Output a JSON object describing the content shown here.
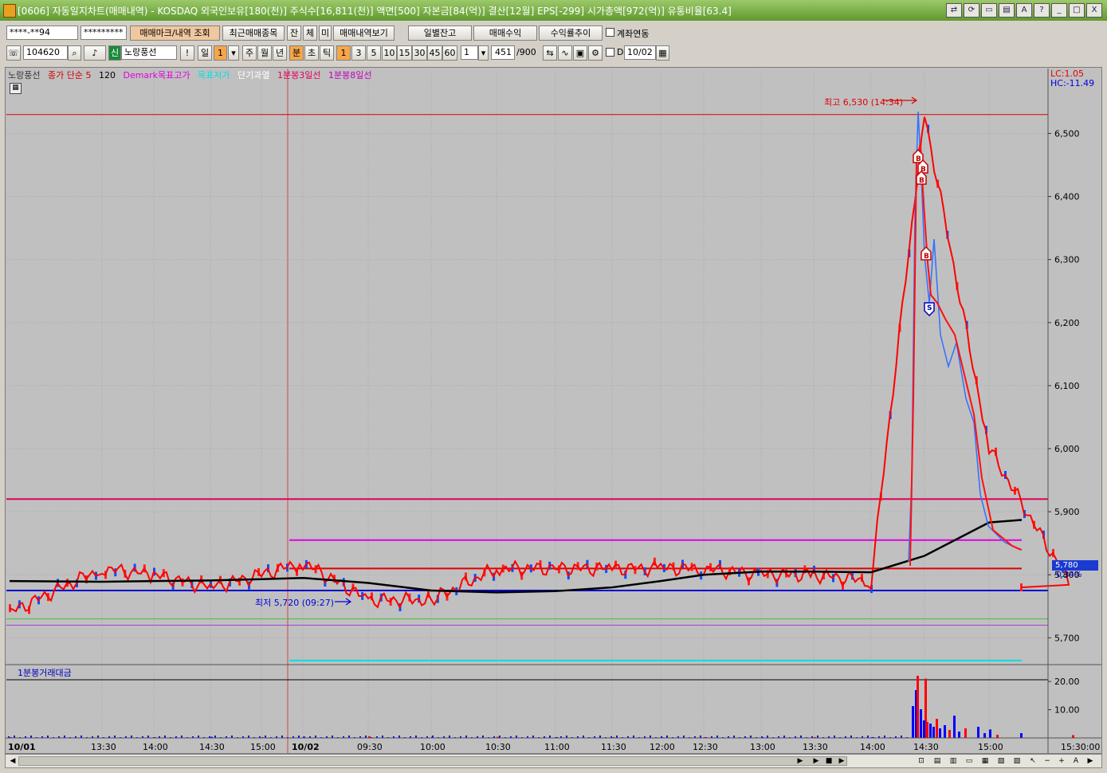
{
  "window": {
    "title": "[0606] 자동일지차트(매매내역) - KOSDAQ 외국인보유[180(천)] 주식수[16,811(천)] 액면[500] 자본금[84(억)] 결산[12월] EPS[-299] 시가총액[972(억)] 유통비율[63.4]",
    "buttons": [
      "⇄",
      "⟳",
      "▭",
      "▤",
      "A",
      "?",
      "_",
      "□",
      "X"
    ]
  },
  "toolbar1": {
    "account": "****-**94",
    "password": "*********",
    "btn_mark": "매매마크/내역 조회",
    "btn_recent": "최근매매종목",
    "btn_jan": "잔",
    "btn_che": "체",
    "btn_mi": "미",
    "btn_history": "매매내역보기",
    "btn_daily": "일별잔고",
    "btn_profit": "매매수익",
    "btn_trend": "수익률추이",
    "chk_link_label": "계좌연동"
  },
  "toolbar2": {
    "code": "104620",
    "new_badge": "신",
    "name": "노랑풍선",
    "excl": "!",
    "period_day": "일",
    "period_num": "1",
    "p_week": "주",
    "p_month": "월",
    "p_year": "년",
    "p_min": "분",
    "p_sec": "초",
    "p_tick": "틱",
    "intervals": [
      "1",
      "3",
      "5",
      "10",
      "15",
      "30",
      "45",
      "60"
    ],
    "spin_value": "1",
    "count": "451",
    "count_total": "/900",
    "chk_d_label": "D",
    "date": "10/02"
  },
  "legend": {
    "stock": "노랑풍선",
    "ma": "종가 단순 5",
    "ma2": "120",
    "demark_high": "Demark목표고가",
    "demark_low": "목표저가",
    "short_over": "단기과열",
    "line3": "1분봉3일선",
    "line8": "1분봉8일선"
  },
  "axis_info": {
    "lc": "LC:1.05",
    "hc": "HC:-11.49"
  },
  "annotations": {
    "high": "최고 6,530 (14:34)",
    "low": "최저 5,720 (09:27)",
    "current_price": "5,780",
    "current_change": "-0.34%",
    "buy_mark": "B",
    "sell_mark": "S"
  },
  "volume": {
    "title": "1분봉거래대금"
  },
  "colors": {
    "chart_bg": "#c0c0c0",
    "up": "#ff0000",
    "down": "#0000ff",
    "ma120": "#000000",
    "demark_high": "#ff00ff",
    "demark_low": "#00d8d8",
    "line3": "#e00060",
    "line8": "#a000e0"
  },
  "chart_data": {
    "type": "line",
    "title": "",
    "x": [
      "10/01",
      "13:30",
      "14:00",
      "14:30",
      "15:00",
      "10/02",
      "09:30",
      "10:00",
      "10:30",
      "11:00",
      "11:30",
      "12:00",
      "12:30",
      "13:00",
      "13:30",
      "14:00",
      "14:30",
      "15:00",
      "15:30:00"
    ],
    "y_ticks": [
      "6,500",
      "6,400",
      "6,300",
      "6,200",
      "6,100",
      "6,000",
      "5,900",
      "5,800",
      "5,700"
    ],
    "ylim": [
      5660,
      6560
    ],
    "volume_ticks": [
      "20.00",
      "10.00"
    ],
    "volume_ylim": [
      0,
      22
    ],
    "series": [
      {
        "name": "노랑풍선",
        "x": [
          "10/01",
          "13:30",
          "14:00",
          "14:30",
          "15:00",
          "10/02",
          "09:30",
          "10:00",
          "10:30",
          "11:00",
          "11:30",
          "12:00",
          "12:30",
          "13:00",
          "13:30",
          "14:00",
          "14:30",
          "15:00",
          "15:30:00"
        ],
        "values": [
          5740,
          5810,
          5800,
          5780,
          5800,
          5820,
          5760,
          5760,
          5810,
          5810,
          5810,
          5810,
          5810,
          5800,
          5800,
          5790,
          6530,
          6000,
          5780
        ]
      },
      {
        "name": "120",
        "x": [
          "10/01",
          "13:30",
          "14:00",
          "14:30",
          "15:00",
          "10/02",
          "09:30",
          "10:00",
          "10:30",
          "11:00",
          "11:30",
          "12:00",
          "12:30",
          "13:00",
          "13:30",
          "14:00",
          "14:30",
          "15:00",
          "15:30:00"
        ],
        "values": [
          5790,
          5789,
          5790,
          5791,
          5793,
          5795,
          5787,
          5775,
          5772,
          5774,
          5780,
          5790,
          5800,
          5805,
          5805,
          5804,
          5830,
          5883,
          5887
        ]
      },
      {
        "name": "1분봉거래대금",
        "x": [
          "10/01",
          "13:30",
          "14:00",
          "14:30",
          "15:00",
          "10/02",
          "09:30",
          "10:00",
          "10:30",
          "11:00",
          "11:30",
          "12:00",
          "12:30",
          "13:00",
          "13:30",
          "14:00",
          "14:30",
          "15:00",
          "15:30:00"
        ],
        "values": [
          0.3,
          0.2,
          0.3,
          0.4,
          0.3,
          0.5,
          0.6,
          0.4,
          0.4,
          0.3,
          0.3,
          0.3,
          0.3,
          0.3,
          0.3,
          0.3,
          21,
          3,
          1
        ]
      }
    ],
    "hlines": [
      {
        "name": "최고",
        "value": 6530
      },
      {
        "name": "1분봉3일선",
        "value": 5920
      },
      {
        "name": "Demark목표고가",
        "value": 5855
      },
      {
        "name": "1분봉8일선",
        "value": 5810
      },
      {
        "name": "current",
        "value": 5775
      },
      {
        "name": "green",
        "value": 5730
      },
      {
        "name": "purple",
        "value": 5720
      },
      {
        "name": "목표저가",
        "value": 5664
      }
    ],
    "grid": true,
    "legend": "top-left"
  }
}
